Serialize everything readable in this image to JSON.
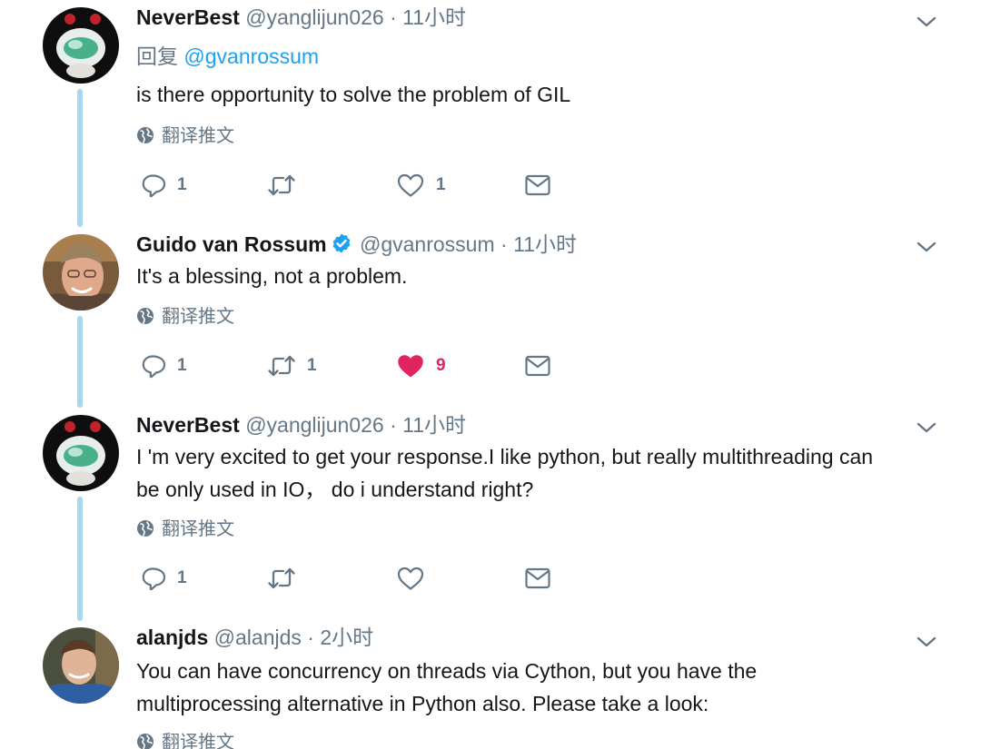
{
  "translate_label": "翻译推文",
  "tweets": [
    {
      "name": "NeverBest",
      "handle": "@yanglijun026",
      "separator": "·",
      "time": "11小时",
      "reply_prefix": "回复",
      "reply_mention": "@gvanrossum",
      "text": "is there opportunity to solve the problem of GIL",
      "reply_count": "1",
      "retweet_count": "",
      "like_count": "1",
      "liked": false
    },
    {
      "name": "Guido van Rossum",
      "verified": true,
      "handle": "@gvanrossum",
      "separator": "·",
      "time": "11小时",
      "text": "It's a blessing, not a problem.",
      "reply_count": "1",
      "retweet_count": "1",
      "like_count": "9",
      "liked": true
    },
    {
      "name": "NeverBest",
      "handle": "@yanglijun026",
      "separator": "·",
      "time": "11小时",
      "text_lines": [
        "I 'm very excited to get your response.I like python, but really multithreading can",
        "be only used in IO， do i understand right?"
      ],
      "reply_count": "1",
      "retweet_count": "",
      "like_count": "",
      "liked": false
    },
    {
      "name": "alanjds",
      "handle": "@alanjds",
      "separator": "·",
      "time": "2小时",
      "text_lines": [
        "You can have concurrency on threads via Cython, but you have the",
        "multiprocessing alternative in Python also. Please take a look:"
      ]
    }
  ],
  "colors": {
    "thread_line": "#a7d6f1",
    "link": "#1da1f2",
    "muted": "#657786",
    "like_active": "#e0245e",
    "verified": "#1da1f2"
  },
  "icons": [
    "chevron-down-icon",
    "verified-icon",
    "globe-icon",
    "reply-icon",
    "retweet-icon",
    "heart-icon",
    "mail-icon"
  ]
}
